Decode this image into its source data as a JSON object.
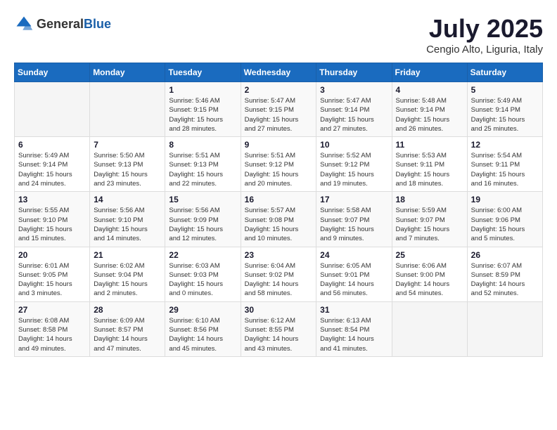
{
  "header": {
    "logo_general": "General",
    "logo_blue": "Blue",
    "month": "July 2025",
    "location": "Cengio Alto, Liguria, Italy"
  },
  "days_of_week": [
    "Sunday",
    "Monday",
    "Tuesday",
    "Wednesday",
    "Thursday",
    "Friday",
    "Saturday"
  ],
  "weeks": [
    [
      {
        "day": "",
        "detail": ""
      },
      {
        "day": "",
        "detail": ""
      },
      {
        "day": "1",
        "detail": "Sunrise: 5:46 AM\nSunset: 9:15 PM\nDaylight: 15 hours\nand 28 minutes."
      },
      {
        "day": "2",
        "detail": "Sunrise: 5:47 AM\nSunset: 9:15 PM\nDaylight: 15 hours\nand 27 minutes."
      },
      {
        "day": "3",
        "detail": "Sunrise: 5:47 AM\nSunset: 9:14 PM\nDaylight: 15 hours\nand 27 minutes."
      },
      {
        "day": "4",
        "detail": "Sunrise: 5:48 AM\nSunset: 9:14 PM\nDaylight: 15 hours\nand 26 minutes."
      },
      {
        "day": "5",
        "detail": "Sunrise: 5:49 AM\nSunset: 9:14 PM\nDaylight: 15 hours\nand 25 minutes."
      }
    ],
    [
      {
        "day": "6",
        "detail": "Sunrise: 5:49 AM\nSunset: 9:14 PM\nDaylight: 15 hours\nand 24 minutes."
      },
      {
        "day": "7",
        "detail": "Sunrise: 5:50 AM\nSunset: 9:13 PM\nDaylight: 15 hours\nand 23 minutes."
      },
      {
        "day": "8",
        "detail": "Sunrise: 5:51 AM\nSunset: 9:13 PM\nDaylight: 15 hours\nand 22 minutes."
      },
      {
        "day": "9",
        "detail": "Sunrise: 5:51 AM\nSunset: 9:12 PM\nDaylight: 15 hours\nand 20 minutes."
      },
      {
        "day": "10",
        "detail": "Sunrise: 5:52 AM\nSunset: 9:12 PM\nDaylight: 15 hours\nand 19 minutes."
      },
      {
        "day": "11",
        "detail": "Sunrise: 5:53 AM\nSunset: 9:11 PM\nDaylight: 15 hours\nand 18 minutes."
      },
      {
        "day": "12",
        "detail": "Sunrise: 5:54 AM\nSunset: 9:11 PM\nDaylight: 15 hours\nand 16 minutes."
      }
    ],
    [
      {
        "day": "13",
        "detail": "Sunrise: 5:55 AM\nSunset: 9:10 PM\nDaylight: 15 hours\nand 15 minutes."
      },
      {
        "day": "14",
        "detail": "Sunrise: 5:56 AM\nSunset: 9:10 PM\nDaylight: 15 hours\nand 14 minutes."
      },
      {
        "day": "15",
        "detail": "Sunrise: 5:56 AM\nSunset: 9:09 PM\nDaylight: 15 hours\nand 12 minutes."
      },
      {
        "day": "16",
        "detail": "Sunrise: 5:57 AM\nSunset: 9:08 PM\nDaylight: 15 hours\nand 10 minutes."
      },
      {
        "day": "17",
        "detail": "Sunrise: 5:58 AM\nSunset: 9:07 PM\nDaylight: 15 hours\nand 9 minutes."
      },
      {
        "day": "18",
        "detail": "Sunrise: 5:59 AM\nSunset: 9:07 PM\nDaylight: 15 hours\nand 7 minutes."
      },
      {
        "day": "19",
        "detail": "Sunrise: 6:00 AM\nSunset: 9:06 PM\nDaylight: 15 hours\nand 5 minutes."
      }
    ],
    [
      {
        "day": "20",
        "detail": "Sunrise: 6:01 AM\nSunset: 9:05 PM\nDaylight: 15 hours\nand 3 minutes."
      },
      {
        "day": "21",
        "detail": "Sunrise: 6:02 AM\nSunset: 9:04 PM\nDaylight: 15 hours\nand 2 minutes."
      },
      {
        "day": "22",
        "detail": "Sunrise: 6:03 AM\nSunset: 9:03 PM\nDaylight: 15 hours\nand 0 minutes."
      },
      {
        "day": "23",
        "detail": "Sunrise: 6:04 AM\nSunset: 9:02 PM\nDaylight: 14 hours\nand 58 minutes."
      },
      {
        "day": "24",
        "detail": "Sunrise: 6:05 AM\nSunset: 9:01 PM\nDaylight: 14 hours\nand 56 minutes."
      },
      {
        "day": "25",
        "detail": "Sunrise: 6:06 AM\nSunset: 9:00 PM\nDaylight: 14 hours\nand 54 minutes."
      },
      {
        "day": "26",
        "detail": "Sunrise: 6:07 AM\nSunset: 8:59 PM\nDaylight: 14 hours\nand 52 minutes."
      }
    ],
    [
      {
        "day": "27",
        "detail": "Sunrise: 6:08 AM\nSunset: 8:58 PM\nDaylight: 14 hours\nand 49 minutes."
      },
      {
        "day": "28",
        "detail": "Sunrise: 6:09 AM\nSunset: 8:57 PM\nDaylight: 14 hours\nand 47 minutes."
      },
      {
        "day": "29",
        "detail": "Sunrise: 6:10 AM\nSunset: 8:56 PM\nDaylight: 14 hours\nand 45 minutes."
      },
      {
        "day": "30",
        "detail": "Sunrise: 6:12 AM\nSunset: 8:55 PM\nDaylight: 14 hours\nand 43 minutes."
      },
      {
        "day": "31",
        "detail": "Sunrise: 6:13 AM\nSunset: 8:54 PM\nDaylight: 14 hours\nand 41 minutes."
      },
      {
        "day": "",
        "detail": ""
      },
      {
        "day": "",
        "detail": ""
      }
    ]
  ]
}
